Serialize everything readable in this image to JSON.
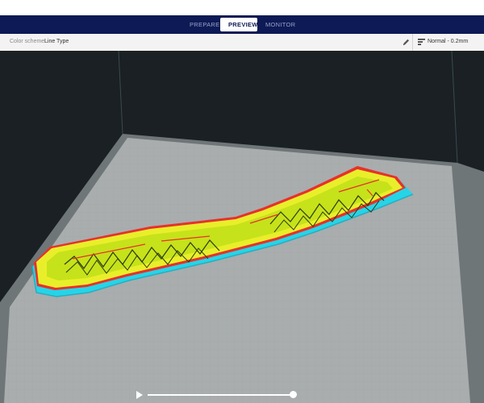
{
  "stage_tabs": [
    {
      "label": "PREPARE",
      "active": false
    },
    {
      "label": "PREVIEW",
      "active": true
    },
    {
      "label": "MONITOR",
      "active": false
    }
  ],
  "header": {
    "color_scheme_label": "Color scheme",
    "color_scheme_value": "Line Type",
    "profile": "Normal - 0.2mm"
  },
  "colors": {
    "stage_bar": "#0d1a55",
    "viewport_bg": "#1a2024",
    "build_plate": "#a9adae",
    "wall_outer": "#e8ef2a",
    "infill": "#c6e21a",
    "skirt": "#26d4e8",
    "travel": "#e8302b"
  },
  "icons": {
    "edit": "pencil-icon",
    "profile": "profile-sliders-icon",
    "play": "play-icon"
  },
  "layer_slider": {
    "progress": 1.0
  }
}
